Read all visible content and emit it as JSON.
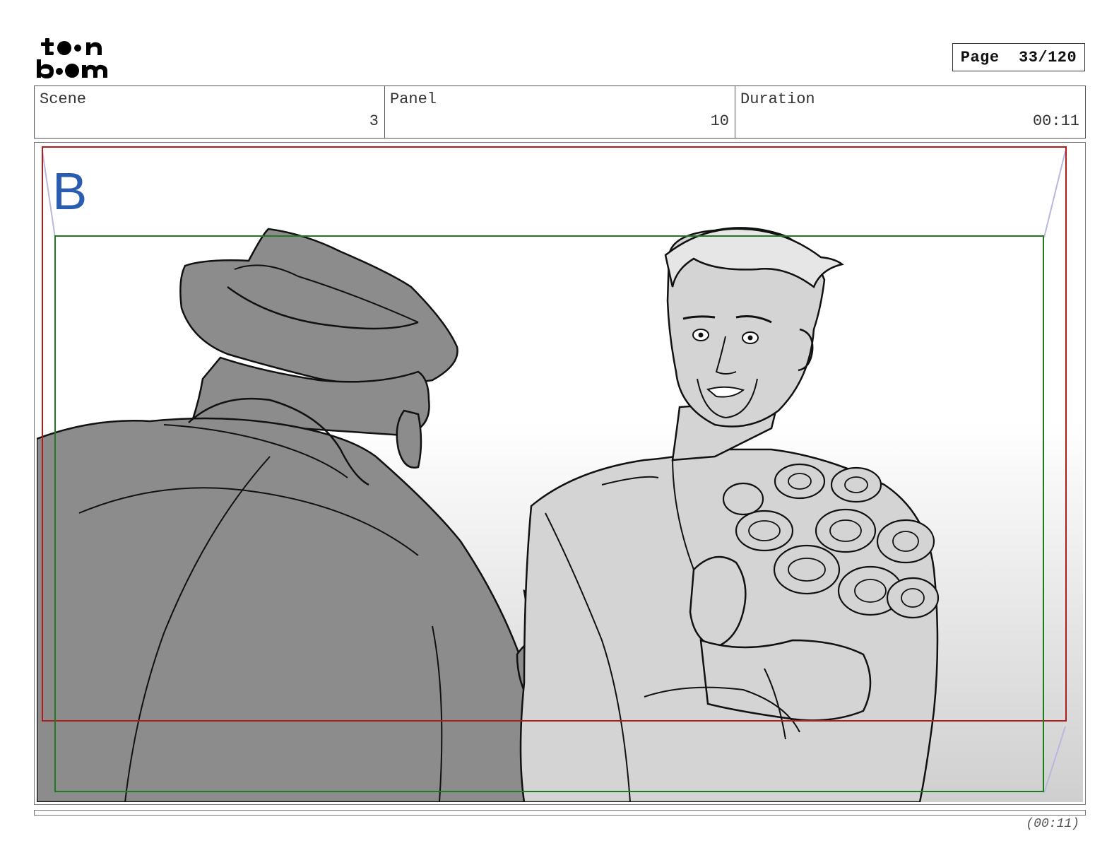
{
  "brand": {
    "logo_text_top": "toon",
    "logo_text_bottom": "boom"
  },
  "page": {
    "label": "Page",
    "number": "33/120",
    "display": "Page  33/120"
  },
  "info": {
    "scene_label": "Scene",
    "scene_value": "3",
    "panel_label": "Panel",
    "panel_value": "10",
    "duration_label": "Duration",
    "duration_value": "00:11"
  },
  "panel": {
    "layer_marker": "B",
    "marker_color": "#2a5db0",
    "safe_frame_color": "#b01c1c",
    "action_frame_color": "#1f7a1f"
  },
  "footer": {
    "timecode": "(00:11)"
  }
}
